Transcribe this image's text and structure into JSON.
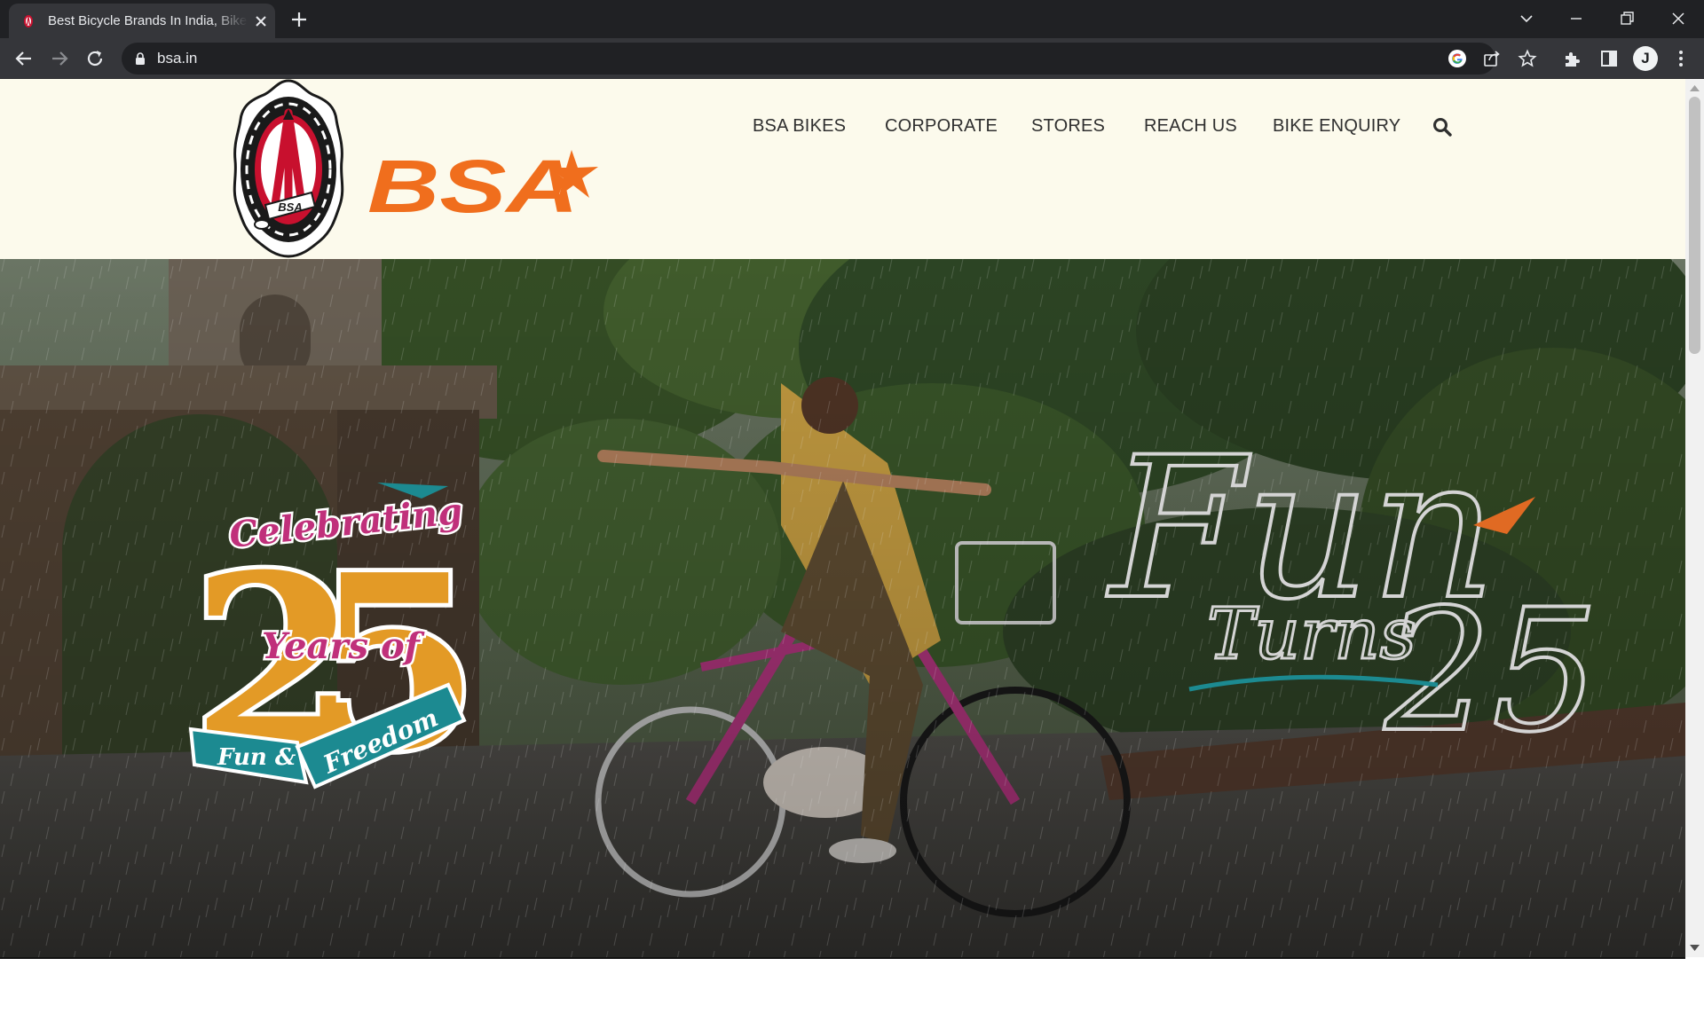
{
  "browser": {
    "tab_title": "Best Bicycle Brands In India, Bikes",
    "url": "bsa.in",
    "profile_initial": "J",
    "icons": [
      "bsa-favicon",
      "close-icon",
      "new-tab-icon",
      "tab-search-icon",
      "minimize-icon",
      "restore-icon",
      "window-close-icon",
      "back-icon",
      "forward-icon",
      "reload-icon",
      "lock-icon",
      "google-icon",
      "share-icon",
      "bookmark-star-icon",
      "extensions-icon",
      "side-panel-icon",
      "menu-icon"
    ]
  },
  "site": {
    "brand": "BSA",
    "emblem_text": "BSA",
    "nav": [
      "BSA BIKES",
      "CORPORATE",
      "STORES",
      "REACH US",
      "BIKE ENQUIRY"
    ],
    "search_icon": "search-icon",
    "colors": {
      "header_bg": "#fcfaec",
      "brand_orange": "#f06e1d",
      "emblem_red": "#c8102e"
    }
  },
  "hero": {
    "badge": {
      "line1": "Celebrating",
      "number": "25",
      "line2": "Years of",
      "ribbon1": "Fun &",
      "ribbon2": "Freedom"
    },
    "tagline": {
      "word1": "Fun",
      "word2": "Turns",
      "number": "25"
    },
    "colors": {
      "badge_orange": "#e39a26",
      "badge_magenta": "#c0307b",
      "ribbon_teal": "#1c8a91",
      "tagline_grey": "#c8c8c8"
    }
  }
}
